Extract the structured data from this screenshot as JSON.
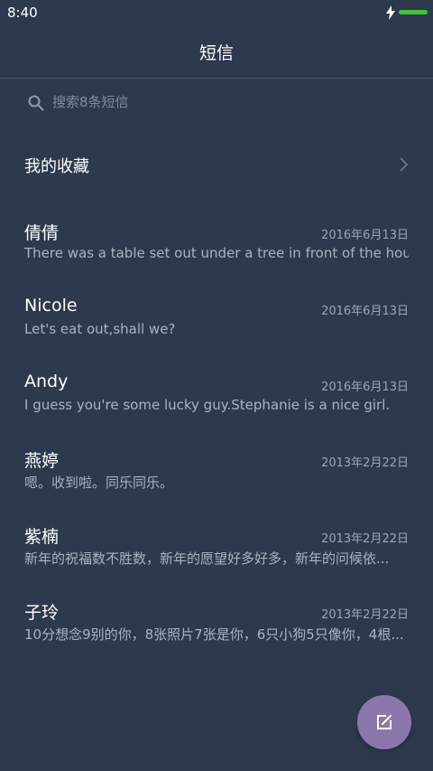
{
  "status_bar": {
    "time": "8:40"
  },
  "header": {
    "title": "短信"
  },
  "search": {
    "placeholder": "搜索8条短信",
    "value": ""
  },
  "favorites": {
    "label": "我的收藏"
  },
  "threads": [
    {
      "name": "倩倩",
      "date": "2016年6月13日",
      "preview": "There was a table set out under a tree in front of the hous"
    },
    {
      "name": "Nicole",
      "date": "2016年6月13日",
      "preview": "Let's eat out,shall we?"
    },
    {
      "name": "Andy",
      "date": "2016年6月13日",
      "preview": "I guess you're some lucky guy.Stephanie is a nice girl."
    },
    {
      "name": "燕婷",
      "date": "2013年2月22日",
      "preview": "嗯。收到啦。同乐同乐。"
    },
    {
      "name": "紫楠",
      "date": "2013年2月22日",
      "preview": "新年的祝福数不胜数，新年的愿望好多好多，新年的问候依..."
    },
    {
      "name": "子玲",
      "date": "2013年2月22日",
      "preview": "10分想念9别的你，8张照片7张是你，6只小狗5只像你，4根..."
    }
  ],
  "icons": {
    "search": "search-icon",
    "chevron": "chevron-right-icon",
    "compose": "compose-icon",
    "bolt": "bolt-icon",
    "battery": "battery-icon"
  },
  "colors": {
    "background": "#2d3a4d",
    "compose_button": "#8c77ad",
    "battery": "#42c23a"
  }
}
